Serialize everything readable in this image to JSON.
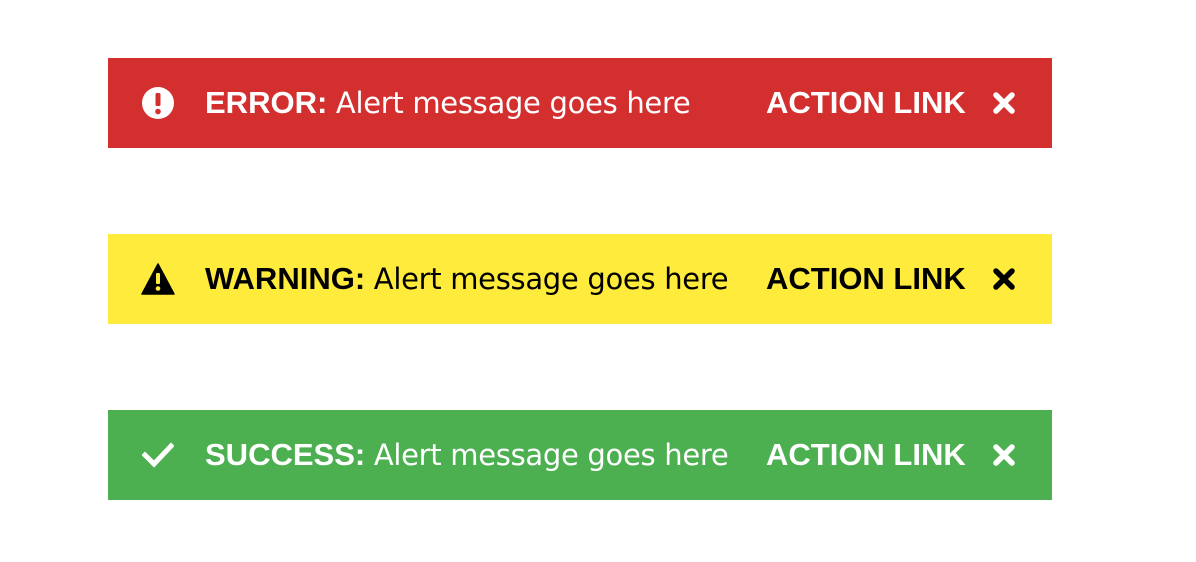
{
  "alerts": [
    {
      "type": "error",
      "label": "ERROR:",
      "message": "Alert message goes here",
      "action": "ACTION LINK",
      "icon": "error-circle-icon",
      "background": "#d32f2f",
      "foreground": "#ffffff"
    },
    {
      "type": "warning",
      "label": "WARNING:",
      "message": "Alert message goes here",
      "action": "ACTION LINK",
      "icon": "warning-triangle-icon",
      "background": "#ffeb3b",
      "foreground": "#000000"
    },
    {
      "type": "success",
      "label": "SUCCESS:",
      "message": "Alert message goes here",
      "action": "ACTION LINK",
      "icon": "check-icon",
      "background": "#4caf50",
      "foreground": "#ffffff"
    }
  ]
}
